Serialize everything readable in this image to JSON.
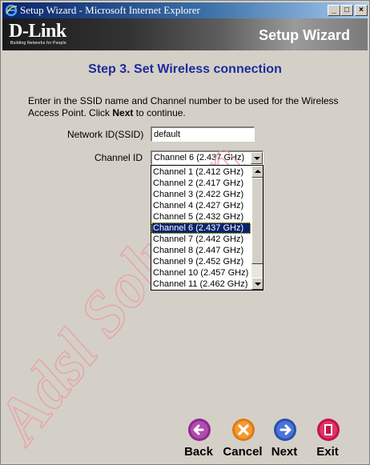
{
  "window": {
    "title": "Setup Wizard - Microsoft Internet Explorer",
    "minimize": "_",
    "maximize": "□",
    "close": "×"
  },
  "header": {
    "logo": "D-Link",
    "tagline": "Building Networks for People",
    "title": "Setup Wizard"
  },
  "step": {
    "title": "Step 3. Set Wireless connection",
    "instructions_pre": "Enter in the SSID name and Channel number to be used for the Wireless Access Point. Click ",
    "instructions_bold": "Next",
    "instructions_post": " to continue."
  },
  "form": {
    "ssid_label": "Network ID(SSID)",
    "ssid_value": "default",
    "channel_label": "Channel ID",
    "channel_selected": "Channel 6 (2.437 GHz)",
    "channel_options": [
      "Channel 1 (2.412 GHz)",
      "Channel 2 (2.417 GHz)",
      "Channel 3 (2.422 GHz)",
      "Channel 4 (2.427 GHz)",
      "Channel 5 (2.432 GHz)",
      "Channel 6 (2.437 GHz)",
      "Channel 7 (2.442 GHz)",
      "Channel 8 (2.447 GHz)",
      "Channel 9 (2.452 GHz)",
      "Channel 10 (2.457 GHz)",
      "Channel 11 (2.462 GHz)"
    ],
    "selected_index": 5
  },
  "nav": {
    "back": "Back",
    "cancel": "Cancel",
    "next": "Next",
    "exit": "Exit"
  },
  "watermark": "Adsl Solution",
  "colors": {
    "step_title": "#1d2b9c",
    "selection": "#0a246a",
    "back": "#8e2a8e",
    "cancel": "#e07a10",
    "next": "#2a4fb0",
    "exit": "#c0144a",
    "watermark": "#e8a0a8"
  }
}
